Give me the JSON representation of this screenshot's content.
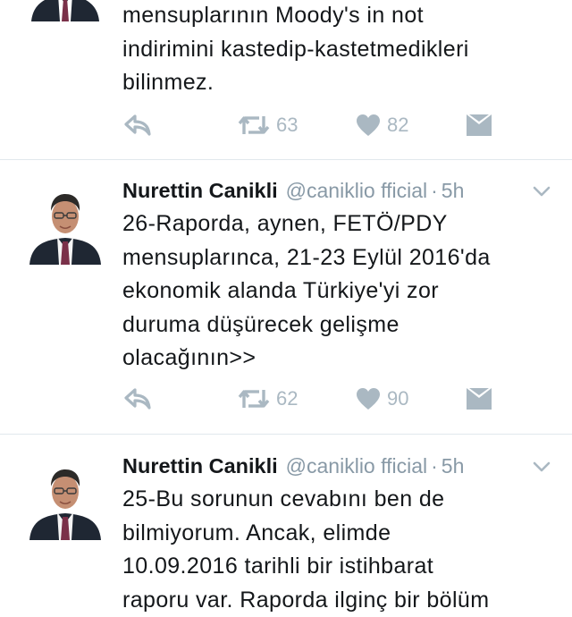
{
  "tweets": [
    {
      "author_name": "",
      "handle": "",
      "time": "",
      "text": "mensuplarının Moody's in not\nindirimini kastedip-kastetmedikleri\nbilinmez.",
      "retweets": "63",
      "likes": "82"
    },
    {
      "author_name": "Nurettin Canikli",
      "handle": "@caniklio fficial",
      "time": "5h",
      "text": "26-Raporda, aynen, FETÖ/PDY\nmensuplarınca, 21-23 Eylül 2016'da\nekonomik alanda Türkiye'yi zor\nduruma düşürecek gelişme\nolacağının>>",
      "retweets": "62",
      "likes": "90"
    },
    {
      "author_name": "Nurettin Canikli",
      "handle": "@caniklio fficial",
      "time": "5h",
      "text": "25-Bu sorunun cevabını ben de\nbilmiyorum. Ancak, elimde\n10.09.2016 tarihli bir istihbarat\nraporu var. Raporda ilginç bir bölüm"
    }
  ],
  "separator": "·",
  "icons": {
    "reply": "reply-icon",
    "retweet": "retweet-icon",
    "like": "heart-icon",
    "message": "direct-message-icon",
    "more": "chevron-down-icon"
  },
  "colors": {
    "text": "#14171a",
    "muted": "#8899a6",
    "icon": "#aab8c2",
    "divider": "#e1e8ed"
  }
}
